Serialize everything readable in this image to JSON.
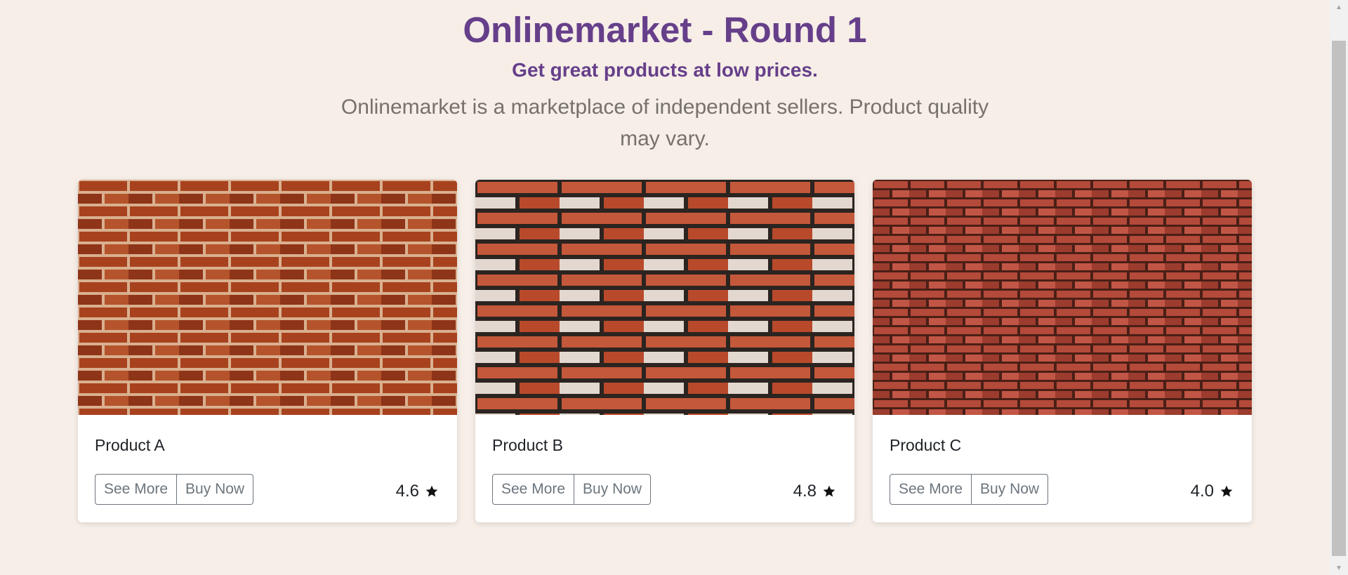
{
  "header": {
    "title": "Onlinemarket - Round 1",
    "subtitle": "Get great products at low prices.",
    "lead": "Onlinemarket is a marketplace of independent sellers. Product quality may vary."
  },
  "products": [
    {
      "name": "Product A",
      "see_more_label": "See More",
      "buy_now_label": "Buy Now",
      "rating": "4.6",
      "image": "brick-wall-image"
    },
    {
      "name": "Product B",
      "see_more_label": "See More",
      "buy_now_label": "Buy Now",
      "rating": "4.8",
      "image": "brick-wall-image"
    },
    {
      "name": "Product C",
      "see_more_label": "See More",
      "buy_now_label": "Buy Now",
      "rating": "4.0",
      "image": "brick-wall-image"
    }
  ],
  "icons": {
    "rating": "star-icon"
  },
  "colors": {
    "accent": "#663f8a",
    "background": "#f6eee7",
    "button_border": "#6c757d"
  }
}
